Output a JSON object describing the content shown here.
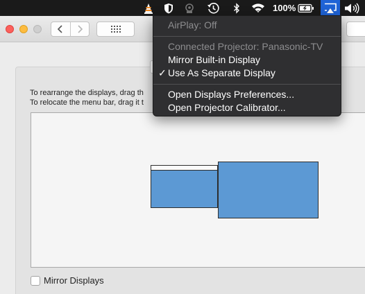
{
  "menubar": {
    "icons": [
      "vlc-icon",
      "shield-icon",
      "security-icon",
      "time-machine-icon",
      "bluetooth-icon",
      "wifi-icon",
      "battery-icon",
      "airplay-icon",
      "volume-icon"
    ],
    "battery_text": "100%",
    "airplay_color": "#1f63d6"
  },
  "airplay_menu": {
    "status": "AirPlay: Off",
    "connected": "Connected Projector: Panasonic-TV",
    "mirror": "Mirror Built-in Display",
    "separate": "Use As Separate Display",
    "separate_checked": true,
    "check_mark": "✓",
    "prefs": "Open Displays Preferences...",
    "calibrator": "Open Projector Calibrator..."
  },
  "pane": {
    "instruction_line1": "To rearrange the displays, drag th",
    "instruction_line2": "To relocate the menu bar, drag it t",
    "mirror_label": "Mirror Displays",
    "mirror_checked": false,
    "display_color": "#5c99d4"
  }
}
